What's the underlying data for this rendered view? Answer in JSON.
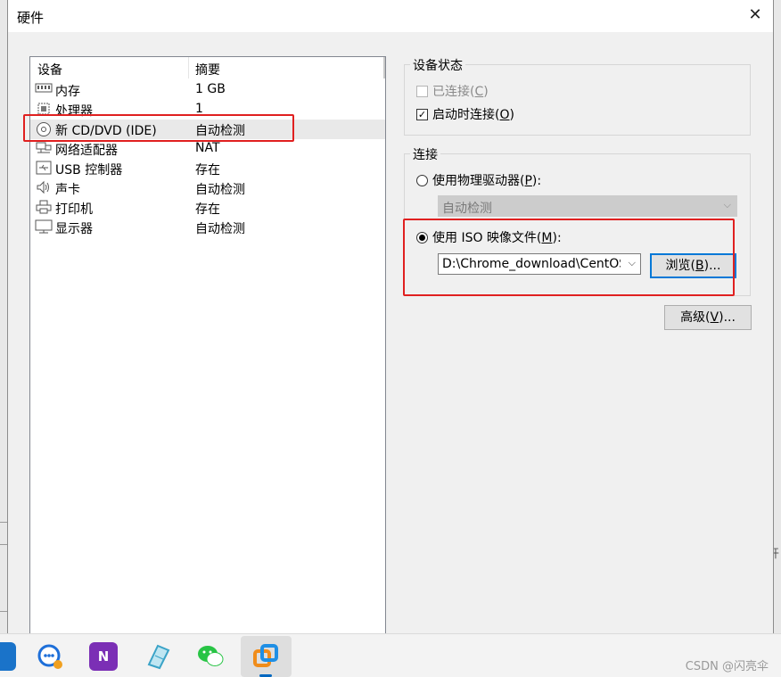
{
  "window": {
    "title": "硬件",
    "close_glyph": "✕"
  },
  "device_list": {
    "columns": {
      "device": "设备",
      "summary": "摘要"
    },
    "rows": [
      {
        "icon": "memory-icon",
        "name": "内存",
        "summary": "1 GB",
        "selected": false
      },
      {
        "icon": "processor-icon",
        "name": "处理器",
        "summary": "1",
        "selected": false
      },
      {
        "icon": "cd-dvd-icon",
        "name": "新 CD/DVD (IDE)",
        "summary": "自动检测",
        "selected": true
      },
      {
        "icon": "network-adapter-icon",
        "name": "网络适配器",
        "summary": "NAT",
        "selected": false
      },
      {
        "icon": "usb-icon",
        "name": "USB 控制器",
        "summary": "存在",
        "selected": false
      },
      {
        "icon": "sound-card-icon",
        "name": "声卡",
        "summary": "自动检测",
        "selected": false
      },
      {
        "icon": "printer-icon",
        "name": "打印机",
        "summary": "存在",
        "selected": false
      },
      {
        "icon": "display-icon",
        "name": "显示器",
        "summary": "自动检测",
        "selected": false
      }
    ]
  },
  "device_status": {
    "legend": "设备状态",
    "connected": {
      "label": "已连接(",
      "mnemonic": "C",
      "suffix": ")",
      "checked": false,
      "enabled": false
    },
    "connect_at_power_on": {
      "label": "启动时连接(",
      "mnemonic": "O",
      "suffix": ")",
      "checked": true,
      "enabled": true
    }
  },
  "connection": {
    "legend": "连接",
    "physical_drive": {
      "label": "使用物理驱动器(",
      "mnemonic": "P",
      "suffix": "):",
      "selected": false
    },
    "physical_drive_value": "自动检测",
    "iso_image": {
      "label": "使用 ISO 映像文件(",
      "mnemonic": "M",
      "suffix": "):",
      "selected": true
    },
    "iso_path": "D:\\Chrome_download\\CentOS-",
    "browse": {
      "label": "浏览(",
      "mnemonic": "B",
      "suffix": ")..."
    }
  },
  "advanced": {
    "label": "高级(",
    "mnemonic": "V",
    "suffix": ")..."
  },
  "taskbar": {
    "apps": [
      "windows-explorer",
      "chat-app",
      "onenote",
      "notepad",
      "wechat",
      "vmware"
    ],
    "watermark": "CSDN @闪亮伞"
  },
  "background": {
    "right_fragment": "开"
  },
  "colors": {
    "highlight_red": "#e02020",
    "focus_blue": "#0078d7",
    "selected_row": "#e9e9e9"
  }
}
